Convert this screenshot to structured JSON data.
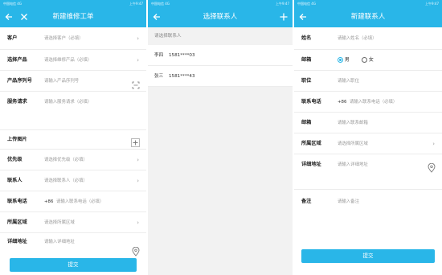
{
  "status": {
    "left": "中国电信 4G",
    "right": "上午9:47"
  },
  "screen1": {
    "title": "新建维修工单",
    "rows": [
      {
        "label": "客户",
        "placeholder": "请选择客户（必填）"
      },
      {
        "label": "选择产品",
        "placeholder": "请选择维修产品（必填）"
      },
      {
        "label": "产品序列号",
        "placeholder": "请输入产品序列号"
      },
      {
        "label": "服务请求",
        "placeholder": "请输入服务请求（必填）"
      },
      {
        "label": "上传图片",
        "placeholder": ""
      },
      {
        "label": "优先级",
        "placeholder": "请选择优先级（必填）"
      },
      {
        "label": "联系人",
        "placeholder": "请选择联系人（必填）"
      },
      {
        "label": "联系电话",
        "prefix": "+86",
        "placeholder": "请输入联系电话（必填）"
      },
      {
        "label": "所属区域",
        "placeholder": "请选择所属区域"
      },
      {
        "label": "详细地址",
        "placeholder": "请输入详细地址"
      }
    ],
    "submit": "提交"
  },
  "screen2": {
    "title": "选择联系人",
    "section": "请选择联系人",
    "contacts": [
      {
        "name": "李四",
        "phone": "1581****03"
      },
      {
        "name": "张三",
        "phone": "1581****43"
      }
    ]
  },
  "screen3": {
    "title": "新建联系人",
    "rows": [
      {
        "label": "姓名",
        "placeholder": "请输入姓名（必填）"
      },
      {
        "label": "邮箱"
      },
      {
        "label": "职位",
        "placeholder": "请输入职位"
      },
      {
        "label": "联系电话",
        "prefix": "+86",
        "placeholder": "请输入联系电话（必填）"
      },
      {
        "label": "邮箱",
        "placeholder": "请输入联系邮箱"
      },
      {
        "label": "所属区域",
        "placeholder": "请选择所属区域"
      },
      {
        "label": "详细地址",
        "placeholder": "请输入详细地址"
      },
      {
        "label": "备注",
        "placeholder": "请输入备注"
      }
    ],
    "gender": {
      "male": "男",
      "female": "女"
    },
    "submit": "提交"
  }
}
